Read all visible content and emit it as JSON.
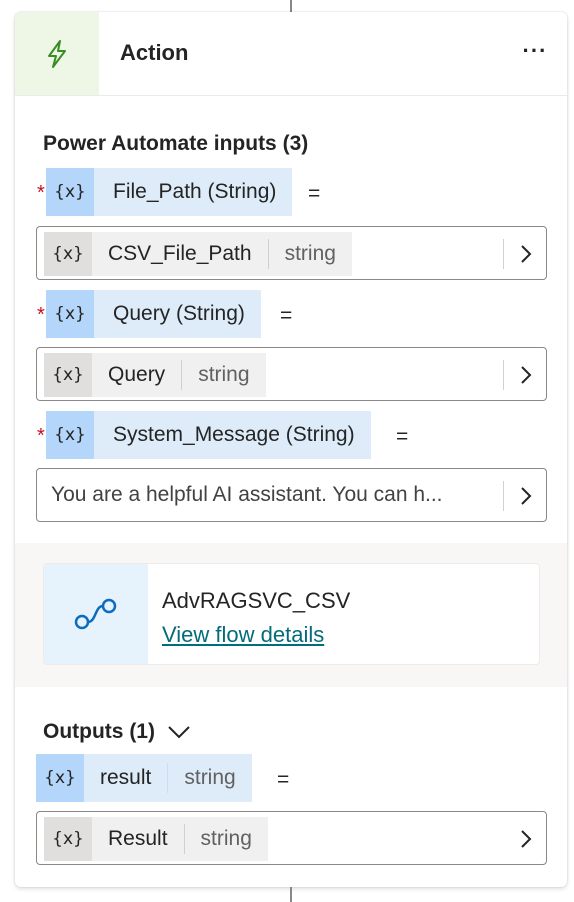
{
  "header": {
    "title": "Action",
    "more_label": "···",
    "icon": "lightning-bolt-icon"
  },
  "inputs": {
    "title": "Power Automate inputs (3)",
    "params": [
      {
        "required_mark": "*",
        "var_badge": "{x}",
        "label": "File_Path (String)",
        "equals": "=",
        "value": {
          "var_badge": "{x}",
          "name": "CSV_File_Path",
          "type": "string"
        }
      },
      {
        "required_mark": "*",
        "var_badge": "{x}",
        "label": "Query (String)",
        "equals": "=",
        "value": {
          "var_badge": "{x}",
          "name": "Query",
          "type": "string"
        }
      },
      {
        "required_mark": "*",
        "var_badge": "{x}",
        "label": "System_Message (String)",
        "equals": "=",
        "value": {
          "text": "You are a helpful AI assistant. You can h..."
        }
      }
    ]
  },
  "flow": {
    "name": "AdvRAGSVC_CSV",
    "link": "View flow details",
    "icon": "flow-icon"
  },
  "outputs": {
    "title": "Outputs (1)",
    "variable": {
      "var_badge": "{x}",
      "name": "result",
      "type": "string",
      "equals": "="
    },
    "value": {
      "var_badge": "{x}",
      "name": "Result",
      "type": "string"
    }
  },
  "colors": {
    "accent_green": "#eef6e6",
    "var_blue": "#deecf9",
    "link": "#036c7a",
    "required": "#c50f1f"
  }
}
